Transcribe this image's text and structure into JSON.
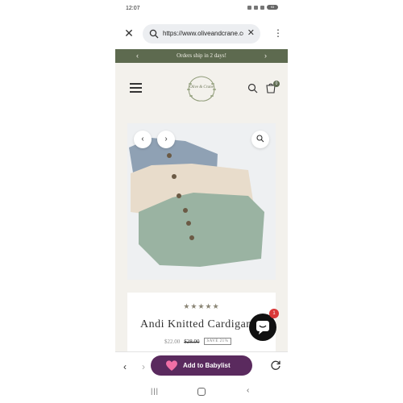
{
  "status": {
    "time": "12:07",
    "battery": "93"
  },
  "browser": {
    "url": "https://www.oliveandcrane.com/products/andi-knitted-cardigan"
  },
  "announcement": {
    "text": "Orders ship in 2 days!"
  },
  "header": {
    "logo_text": "Olive & Crane",
    "cart_count": "0"
  },
  "product": {
    "rating_stars": "★★★★★",
    "title": "Andi Knitted Cardigan",
    "price_sale": "$22.00",
    "price_compare": "$28.00",
    "save_label": "SAVE 21%",
    "cardigan_colors": [
      "#8fa1b4",
      "#e8dccb",
      "#9ab3a2"
    ]
  },
  "chat": {
    "badge_count": "1"
  },
  "bottom_bar": {
    "babylist_label": "Add to Babylist"
  },
  "colors": {
    "accent": "#5d6a4f",
    "babylist": "#5a2a5e",
    "badge": "#d93838"
  }
}
